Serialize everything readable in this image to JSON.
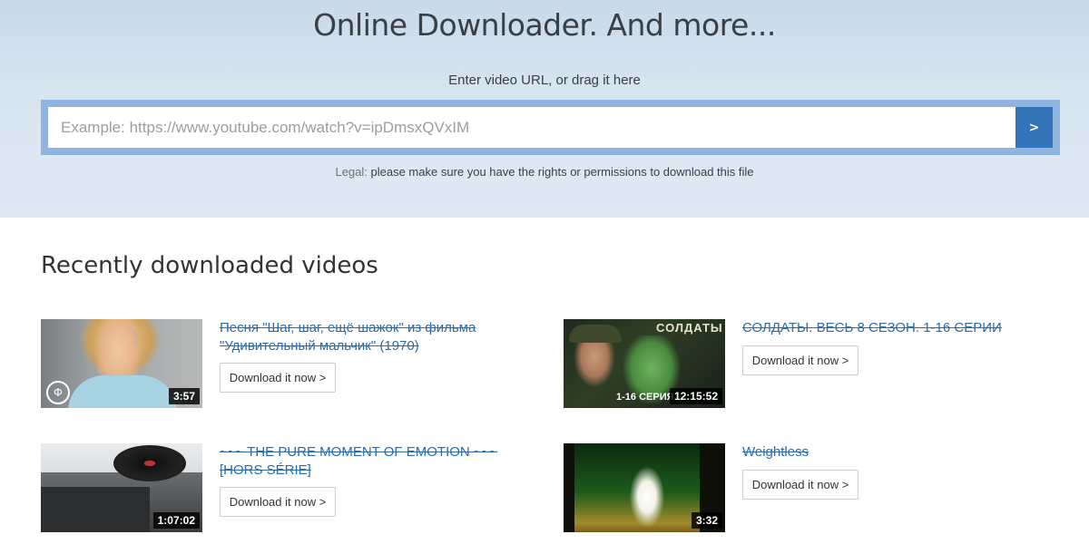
{
  "hero": {
    "title": "Online Downloader. And more...",
    "subtitle": "Enter video URL, or drag it here",
    "input_placeholder": "Example: https://www.youtube.com/watch?v=ipDmsxQVxIM",
    "input_value": "",
    "go_button_label": ">",
    "legal_label": "Legal:",
    "legal_text": "please make sure you have the rights or permissions to download this file"
  },
  "recent": {
    "title": "Recently downloaded videos",
    "videos": [
      {
        "title": "Песня \"Шаг, шаг, ещё шажок\" из фильма \"Удивительный мальчик\" (1970)",
        "duration": "3:57",
        "button_label": "Download it now  >"
      },
      {
        "title": "СОЛДАТЫ. ВЕСЬ 8 СЕЗОН. 1-16 СЕРИИ",
        "duration": "12:15:52",
        "button_label": "Download it now  >",
        "thumb_banner": "СОЛДАТЫ",
        "thumb_episode": "1-16 СЕРИЯ"
      },
      {
        "title": "~~~ THE PURE MOMENT OF EMOTION ~~~ [HORS SÉRIE]",
        "duration": "1:07:02",
        "button_label": "Download it now  >"
      },
      {
        "title": "Weightless",
        "duration": "3:32",
        "button_label": "Download it now  >"
      }
    ]
  },
  "colors": {
    "accent": "#3374b8",
    "link": "#2a6bb0",
    "frame": "#8fb4df"
  }
}
